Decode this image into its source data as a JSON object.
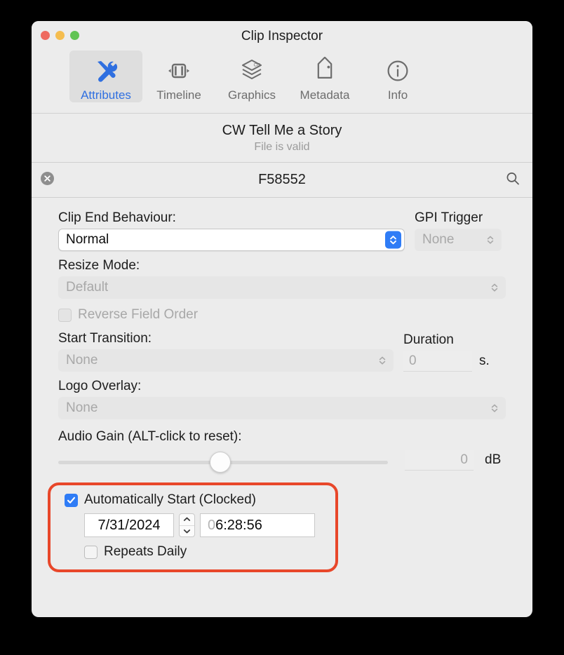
{
  "window": {
    "title": "Clip Inspector",
    "traffic_lights": [
      {
        "name": "close",
        "color": "#ee6a5f"
      },
      {
        "name": "minimize",
        "color": "#f5bd4f"
      },
      {
        "name": "zoom",
        "color": "#61c454"
      }
    ]
  },
  "toolbar": {
    "tabs": [
      {
        "label": "Attributes",
        "icon": "tools-icon",
        "selected": true
      },
      {
        "label": "Timeline",
        "icon": "timeline-clip-icon",
        "selected": false
      },
      {
        "label": "Graphics",
        "icon": "cg-layers-icon",
        "selected": false
      },
      {
        "label": "Metadata",
        "icon": "tag-icon",
        "selected": false
      },
      {
        "label": "Info",
        "icon": "info-circle-icon",
        "selected": false
      }
    ],
    "selected_color": "#2f6fe0"
  },
  "clip_header": {
    "name": "CW Tell Me a Story",
    "status": "File is valid"
  },
  "search": {
    "value": "F58552",
    "clear_icon": "clear-circle-icon",
    "search_icon": "search-icon"
  },
  "form": {
    "clip_end_behaviour": {
      "label": "Clip End Behaviour:",
      "value": "Normal",
      "enabled": true
    },
    "gpi_trigger": {
      "label": "GPI Trigger",
      "value": "None",
      "enabled": false
    },
    "resize_mode": {
      "label": "Resize Mode:",
      "value": "Default",
      "enabled": false
    },
    "reverse_field_order": {
      "label": "Reverse Field Order",
      "checked": false,
      "enabled": false
    },
    "start_transition": {
      "label": "Start Transition:",
      "value": "None",
      "enabled": false
    },
    "duration": {
      "label": "Duration",
      "value": "0",
      "unit": "s.",
      "enabled": false
    },
    "logo_overlay": {
      "label": "Logo Overlay:",
      "value": "None",
      "enabled": false
    },
    "audio_gain": {
      "label": "Audio Gain (ALT-click to reset):",
      "value": "0",
      "unit": "dB",
      "slider_position_percent": 46
    },
    "automatically_start": {
      "label": "Automatically Start (Clocked)",
      "checked": true,
      "date": "7/31/2024",
      "time_leading": "0",
      "time_rest": "6:28:56",
      "stepper": "date-stepper"
    },
    "repeats_daily": {
      "label": "Repeats Daily",
      "checked": false
    }
  },
  "annotation": {
    "highlight_color": "#e8472a"
  }
}
